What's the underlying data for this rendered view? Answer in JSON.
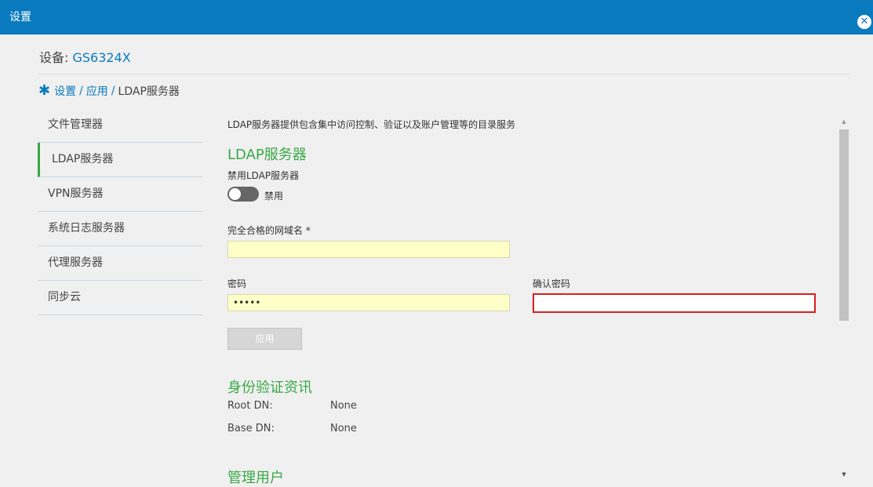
{
  "window": {
    "title": "设置",
    "close_icon": "close-circle-icon"
  },
  "device": {
    "label": "设备:",
    "name": "GS6324X"
  },
  "breadcrumb": {
    "icon": "gear-icon",
    "items": [
      "设置",
      "应用",
      "LDAP服务器"
    ],
    "separator": "/"
  },
  "sidebar": {
    "items": [
      {
        "label": "文件管理器",
        "active": false
      },
      {
        "label": "LDAP服务器",
        "active": true
      },
      {
        "label": "VPN服务器",
        "active": false
      },
      {
        "label": "系统日志服务器",
        "active": false
      },
      {
        "label": "代理服务器",
        "active": false
      },
      {
        "label": "同步云",
        "active": false
      }
    ]
  },
  "main": {
    "description": "LDAP服务器提供包含集中访问控制、验证以及账户管理等的目录服务",
    "section_title": "LDAP服务器",
    "toggle": {
      "label": "禁用LDAP服务器",
      "state_text": "禁用",
      "enabled": false
    },
    "domain": {
      "label": "完全合格的网域名 *",
      "value": ""
    },
    "password": {
      "label": "密码",
      "value": "•••••"
    },
    "confirm_password": {
      "label": "确认密码",
      "value": ""
    },
    "apply_button": "应用",
    "auth": {
      "title": "身份验证资讯",
      "rows": [
        {
          "key": "Root DN:",
          "value": "None"
        },
        {
          "key": "Base DN:",
          "value": "None"
        }
      ]
    },
    "admin_title": "管理用户"
  },
  "colors": {
    "accent": "#0a7abf",
    "green": "#39a845",
    "error": "#d62020",
    "input_bg": "#ffffc8"
  }
}
